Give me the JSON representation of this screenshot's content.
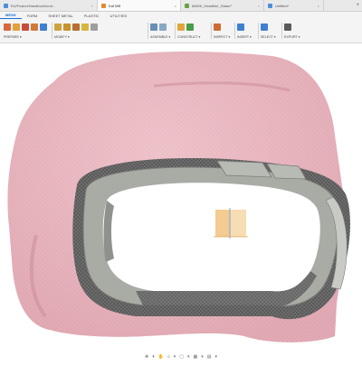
{
  "browser": {
    "tabs": [
      {
        "label": "EU/Fusion/Handbuch/und...",
        "color": "#4a8fd8",
        "active": false
      },
      {
        "label": "Kaf MB",
        "color": "#e38a2b",
        "active": true
      },
      {
        "label": "MASK_Headline_Glass?",
        "color": "#6aa04a",
        "active": false
      },
      {
        "label": "Untitled*",
        "color": "#4a8fd8",
        "active": false
      }
    ],
    "close_glyph": "×",
    "new_tab_glyph": "+"
  },
  "workspace_tabs": [
    "MESH",
    "FORM",
    "SHEET METAL",
    "PLASTIC",
    "UTILITIES"
  ],
  "active_workspace_tab": "MESH",
  "ribbon": {
    "groups": [
      {
        "label": "PREPARE ▾",
        "icons": [
          {
            "name": "create-mesh-icon",
            "color": "#d9673a"
          },
          {
            "name": "insert-mesh-icon",
            "color": "#e1a13c"
          },
          {
            "name": "tessellate-icon",
            "color": "#c94c3b"
          },
          {
            "name": "remesh-icon",
            "color": "#d27a3b"
          },
          {
            "name": "repair-icon",
            "color": "#3f7fd1"
          }
        ]
      },
      {
        "label": "MODIFY ▾",
        "icons": [
          {
            "name": "mesh-edit-icon",
            "color": "#cfa241"
          },
          {
            "name": "shell-icon",
            "color": "#c8922d"
          },
          {
            "name": "offset-icon",
            "color": "#b86d31"
          },
          {
            "name": "combine-icon",
            "color": "#d9b53e"
          },
          {
            "name": "reduce-icon",
            "color": "#9e9e9e"
          }
        ]
      },
      {
        "label": "ASSEMBLE ▾",
        "icons": [
          {
            "name": "joint-icon",
            "color": "#6b8fb6"
          },
          {
            "name": "as-built-joint-icon",
            "color": "#8aa8c6"
          }
        ]
      },
      {
        "label": "CONSTRUCT ▾",
        "icons": [
          {
            "name": "plane-icon",
            "color": "#e0a63c"
          },
          {
            "name": "axis-icon",
            "color": "#4a9c4a"
          }
        ]
      },
      {
        "label": "INSPECT ▾",
        "icons": [
          {
            "name": "measure-icon",
            "color": "#d06b32"
          }
        ]
      },
      {
        "label": "INSERT ▾",
        "icons": [
          {
            "name": "insert-image-icon",
            "color": "#3f7fd1"
          }
        ]
      },
      {
        "label": "SELECT ▾",
        "icons": [
          {
            "name": "select-cursor-icon",
            "color": "#3f7fd1"
          }
        ]
      },
      {
        "label": "EXPORT ▾",
        "icons": [
          {
            "name": "export-icon",
            "color": "#5a5a5a"
          }
        ]
      }
    ]
  },
  "bottom_toolbar": [
    "✥",
    "▾",
    "✋",
    "⌕",
    "▾",
    "▢",
    "▾",
    "▦",
    "▾",
    "▤",
    "▾"
  ],
  "colors": {
    "mesh_pink": "#eab7c0",
    "mesh_shadow": "#c98f9a",
    "part_grey": "#a9aba5",
    "part_dark": "#505050",
    "origin_orange": "#f2c27d"
  }
}
